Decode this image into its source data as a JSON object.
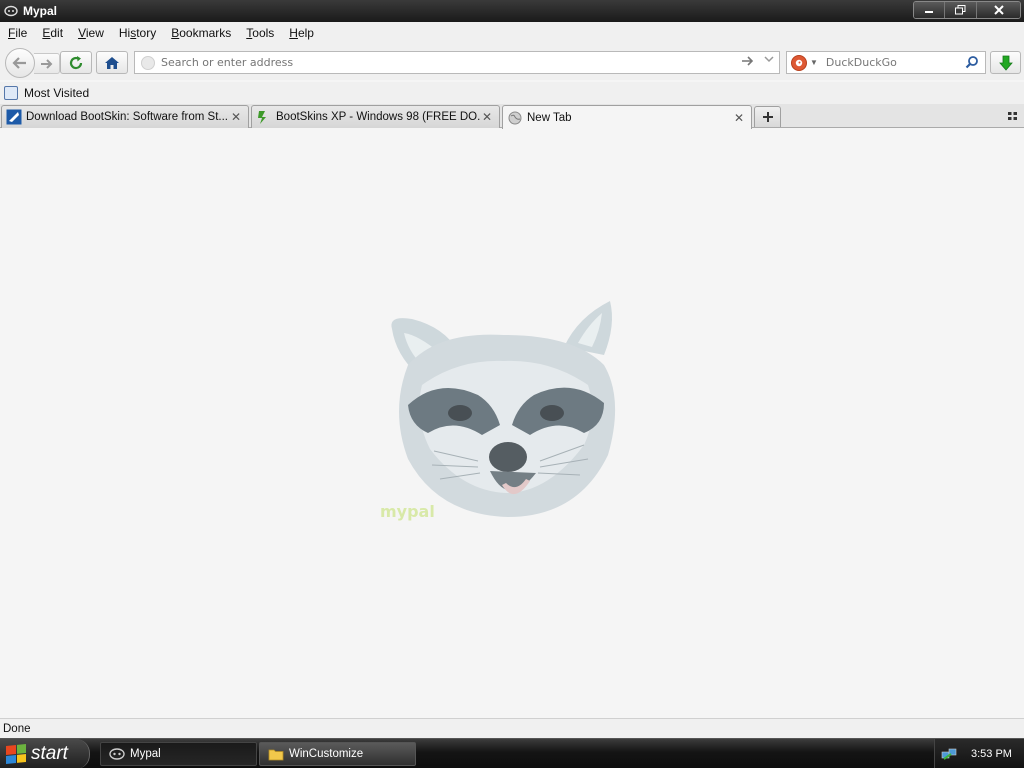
{
  "window": {
    "title": "Mypal",
    "minimize_label": "▬",
    "restore_label": "❐",
    "close_label": "✕"
  },
  "menu": {
    "items": [
      {
        "acc": "F",
        "rest": "ile"
      },
      {
        "acc": "E",
        "rest": "dit"
      },
      {
        "acc": "V",
        "rest": "iew"
      },
      {
        "pre": "Hi",
        "acc": "s",
        "rest": "tory"
      },
      {
        "acc": "B",
        "rest": "ookmarks"
      },
      {
        "acc": "T",
        "rest": "ools"
      },
      {
        "acc": "H",
        "rest": "elp"
      }
    ]
  },
  "navbar": {
    "url_placeholder": "Search or enter address",
    "url_value": "",
    "search_engine": "DuckDuckGo",
    "icons": {
      "back": "back-arrow-icon",
      "forward": "forward-arrow-icon",
      "reload": "reload-icon",
      "home": "home-icon",
      "go": "go-arrow-icon",
      "search": "magnifier-icon",
      "download": "download-arrow-icon"
    }
  },
  "bookmarks": {
    "items": [
      {
        "label": "Most Visited"
      }
    ]
  },
  "tabs": [
    {
      "label": "Download BootSkin: Software from St...",
      "favicon": "stardock-icon",
      "active": false
    },
    {
      "label": "BootSkins XP - Windows 98 (FREE DO...",
      "favicon": "wincustomize-icon",
      "active": false
    },
    {
      "label": "New Tab",
      "favicon": "globe-icon",
      "active": true
    }
  ],
  "content": {
    "logo_text": "mypal"
  },
  "status": {
    "text": "Done"
  },
  "taskbar": {
    "start_label": "start",
    "tasks": [
      {
        "label": "Mypal",
        "icon": "mypal-icon",
        "active": true
      },
      {
        "label": "WinCustomize",
        "icon": "folder-icon",
        "active": false
      }
    ],
    "clock": "3:53 PM"
  },
  "colors": {
    "titlebar": "#1a1a1a",
    "chrome": "#f0f0f0",
    "content_bg": "#f5f5f5",
    "download_arrow": "#22a822",
    "reload_arrow": "#2e8b2e",
    "home_icon": "#1f4f8f"
  }
}
